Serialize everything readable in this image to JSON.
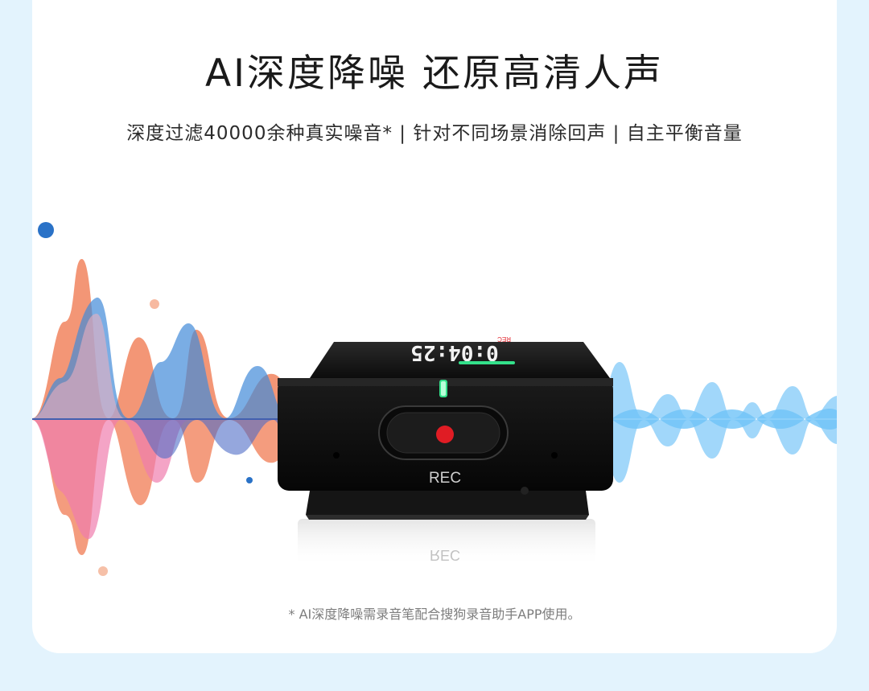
{
  "headline": "AI深度降噪 还原高清人声",
  "subline": "深度过滤40000余种真实噪音* | 针对不同场景消除回声 | 自主平衡音量",
  "device": {
    "screen_time": "0:04:25",
    "screen_rec": "REC",
    "button_label": "REC",
    "reflection_label": "REC"
  },
  "footnote": "* AI深度降噪需录音笔配合搜狗录音助手APP使用。",
  "colors": {
    "background": "#e3f3fd",
    "wave_orange": "#f0764c",
    "wave_pink": "#ee6fa5",
    "wave_blue": "#2e7fd6",
    "wave_light_blue": "#53b6f5",
    "rec_red": "#e01c24",
    "led_green": "#33e08a"
  }
}
